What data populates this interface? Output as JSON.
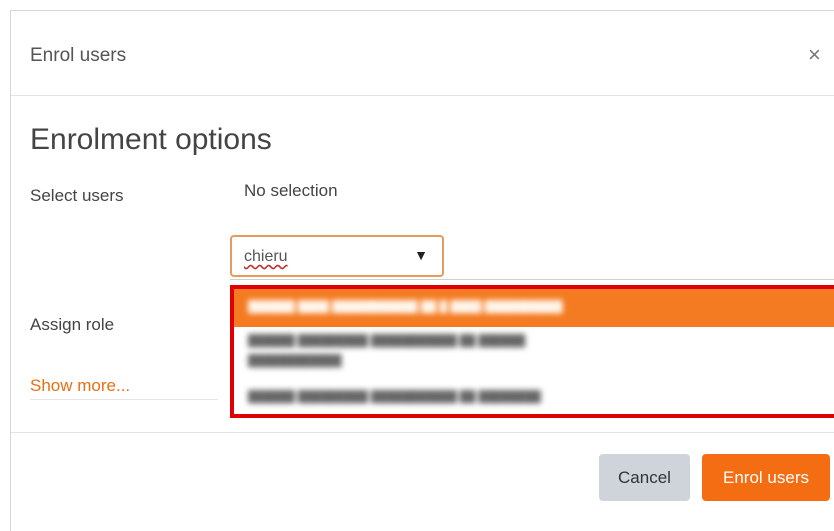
{
  "dialog": {
    "title": "Enrol users",
    "close_icon": "close-icon",
    "close_glyph": "×"
  },
  "section": {
    "title": "Enrolment options"
  },
  "select_users": {
    "label": "Select users",
    "selection_text": "No selection",
    "search_value": "chieru",
    "caret_icon": "caret-down-icon",
    "caret_glyph": "▼"
  },
  "dropdown": {
    "highlight_color": "#f47b22",
    "border_color": "#e00000",
    "options": [
      {
        "state": "highlighted"
      },
      {
        "state": "normal"
      },
      {
        "state": "normal"
      }
    ]
  },
  "assign_role": {
    "label": "Assign role"
  },
  "show_more": {
    "label": "Show more..."
  },
  "footer": {
    "cancel_label": "Cancel",
    "enrol_label": "Enrol users"
  },
  "colors": {
    "accent": "#f46d13",
    "cancel_bg": "#ced4da"
  }
}
